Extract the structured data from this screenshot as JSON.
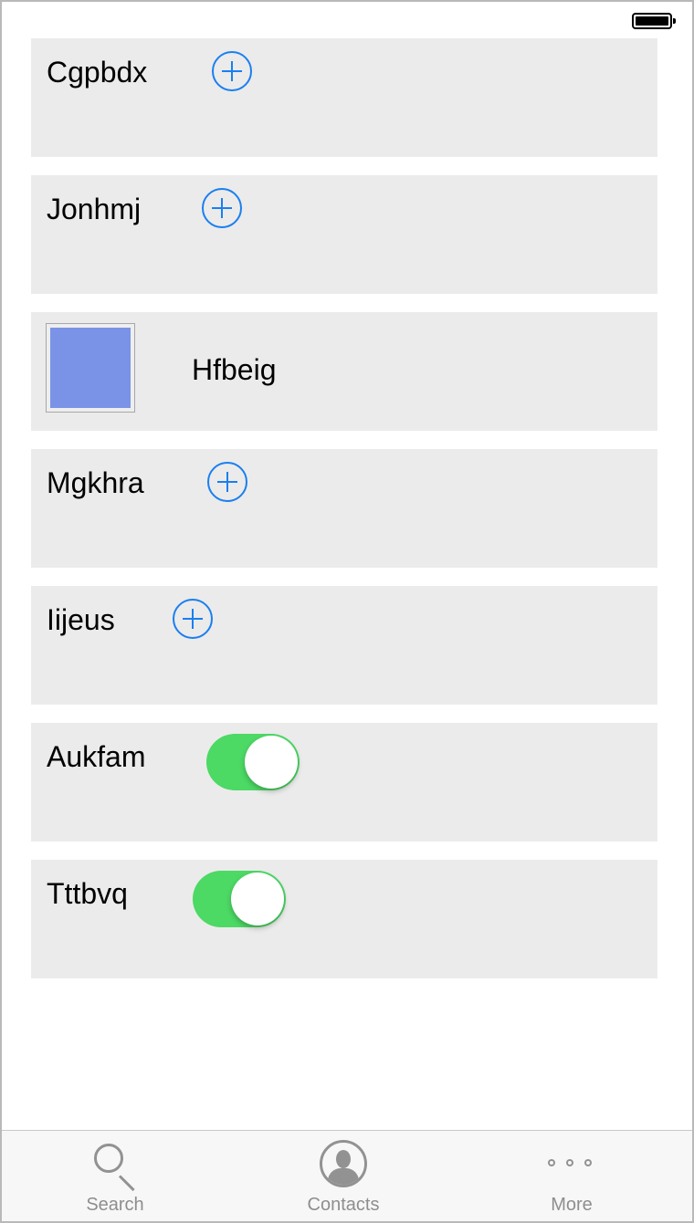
{
  "status_bar": {
    "battery_icon": "battery-full-icon"
  },
  "cells": [
    {
      "type": "add",
      "label": "Cgpbdx",
      "icon": "add-circle-icon"
    },
    {
      "type": "add",
      "label": "Jonhmj",
      "icon": "add-circle-icon"
    },
    {
      "type": "image",
      "label": "Hfbeig",
      "swatch_color": "#7a93e6"
    },
    {
      "type": "add",
      "label": "Mgkhra",
      "icon": "add-circle-icon"
    },
    {
      "type": "add",
      "label": "Iijeus",
      "icon": "add-circle-icon"
    },
    {
      "type": "toggle",
      "label": "Aukfam",
      "on": true,
      "color": "#4cd964"
    },
    {
      "type": "toggle",
      "label": "Tttbvq",
      "on": true,
      "color": "#4cd964"
    }
  ],
  "tab_bar": {
    "tabs": [
      {
        "label": "Search",
        "icon": "search-icon"
      },
      {
        "label": "Contacts",
        "icon": "contact-icon"
      },
      {
        "label": "More",
        "icon": "more-icon"
      }
    ]
  },
  "colors": {
    "accent": "#1a7ff0",
    "cell_background": "#ebebeb",
    "tab_label": "#8e8e8e"
  }
}
